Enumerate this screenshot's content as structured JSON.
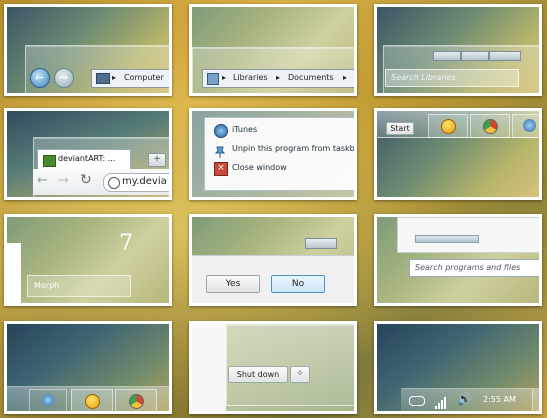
{
  "explorer_nav": {
    "computer_label": "Computer"
  },
  "breadcrumb": {
    "libraries_label": "Libraries",
    "documents_label": "Documents"
  },
  "search_libraries": {
    "placeholder": "Search Libraries"
  },
  "browser": {
    "tab_label": "deviantART: ...",
    "url": "my.devia"
  },
  "jumplist": {
    "items": [
      "iTunes",
      "Unpin this program from taskba",
      "Close window"
    ]
  },
  "taskbar_start": {
    "start_label": "Start"
  },
  "win7_tile": {
    "seven": "7",
    "theme_label": "Morph"
  },
  "dialog": {
    "yes_label": "Yes",
    "no_label": "No"
  },
  "start_search": {
    "placeholder": "Search programs and files"
  },
  "shutdown": {
    "label": "Shut down"
  },
  "tray": {
    "time": "2:55 AM"
  },
  "colors": {
    "frame": "#ffffff",
    "accent_blue": "#4a8fc0"
  }
}
